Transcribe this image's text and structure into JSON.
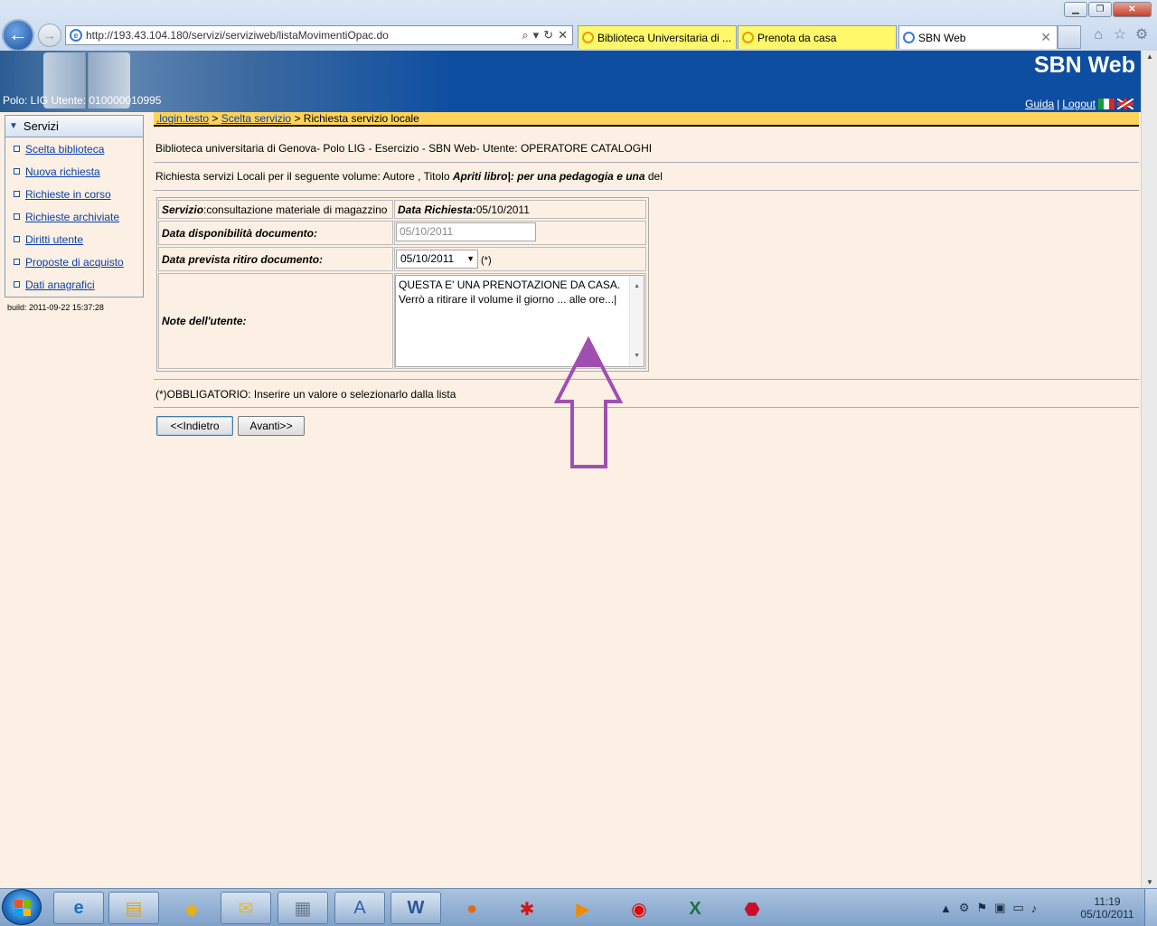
{
  "browser": {
    "url": "http://193.43.104.180/servizi/serviziweb/listaMovimentiOpac.do",
    "tabs": [
      {
        "label": "Biblioteca Universitaria di ..."
      },
      {
        "label": "Prenota da casa"
      },
      {
        "label": "SBN Web"
      }
    ]
  },
  "header": {
    "title": "SBN Web",
    "polo_utente": "Polo: LIG  Utente: 010000010995",
    "guida": "Guida",
    "sep": "|",
    "logout": "Logout"
  },
  "sidebar": {
    "title": "Servizi",
    "items": [
      {
        "label": "Scelta biblioteca"
      },
      {
        "label": "Nuova richiesta"
      },
      {
        "label": "Richieste in corso"
      },
      {
        "label": "Richieste archiviate"
      },
      {
        "label": "Diritti utente"
      },
      {
        "label": "Proposte di acquisto"
      },
      {
        "label": "Dati anagrafici"
      }
    ],
    "build": "build:  2011-09-22 15:37:28"
  },
  "breadcrumb": {
    "item1": ".login.testo",
    "sep1": " > ",
    "item2": "Scelta servizio",
    "sep2": " > ",
    "current": "Richiesta servizio locale"
  },
  "info": {
    "line1": "Biblioteca universitaria di Genova- Polo LIG - Esercizio - SBN Web- Utente: OPERATORE CATALOGHI",
    "line2_prefix": "Richiesta servizi Locali per il seguente volume: Autore , Titolo ",
    "line2_bold": "Apriti libro|: per una pedagogia e una",
    "line2_suffix": " del"
  },
  "form": {
    "servizio_label": "Servizio",
    "servizio_value": ":consultazione materiale di magazzino",
    "data_richiesta_label": "Data Richiesta:",
    "data_richiesta_value": "05/10/2011",
    "disponibilita_label": "Data disponibilità documento:",
    "disponibilita_value": "05/10/2011",
    "ritiro_label": "Data prevista ritiro documento:",
    "ritiro_value": "05/10/2011",
    "ritiro_required": "(*)",
    "note_label": "Note dell'utente:",
    "note_value": "QUESTA E' UNA PRENOTAZIONE DA CASA. Verrò a ritirare il volume il giorno ... alle ore...|"
  },
  "footer": {
    "obbligatorio": "(*)OBBLIGATORIO: Inserire un valore o selezionarlo dalla lista",
    "back_button": "<<Indietro",
    "next_button": "Avanti>>"
  },
  "taskbar": {
    "time": "11:19",
    "date": "05/10/2011"
  },
  "colors": {
    "header_bg": "#0e4ea1",
    "breadcrumb_bg": "#fdd35b",
    "page_bg": "#fbf0e3",
    "annotation_arrow": "#a04fb0"
  }
}
